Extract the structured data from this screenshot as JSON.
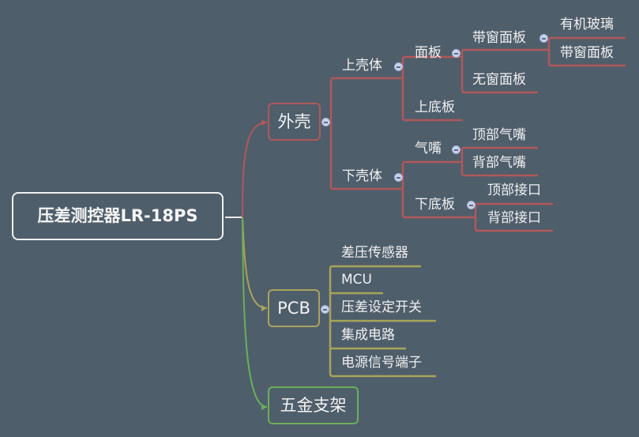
{
  "root": {
    "label": "压差测控器LR-18PS"
  },
  "colors": {
    "background": "#4f5e6b",
    "branch_shell": "#b0585a",
    "branch_pcb": "#a8a35a",
    "branch_hardware": "#6aaf5a",
    "root_border": "#f0f0f0"
  },
  "branches": {
    "shell": {
      "label": "外壳",
      "upper": {
        "label": "上壳体",
        "panel": {
          "label": "面板",
          "window_panel": {
            "label": "带窗面板",
            "children": [
              "有机玻璃",
              "带窗面板"
            ]
          },
          "no_window_panel": {
            "label": "无窗面板"
          }
        },
        "upper_base": {
          "label": "上底板"
        }
      },
      "lower": {
        "label": "下壳体",
        "nozzle": {
          "label": "气嘴",
          "children": [
            "顶部气嘴",
            "背部气嘴"
          ]
        },
        "lower_base": {
          "label": "下底板",
          "children": [
            "顶部接口",
            "背部接口"
          ]
        }
      }
    },
    "pcb": {
      "label": "PCB",
      "children": [
        "差压传感器",
        "MCU",
        "压差设定开关",
        "集成电路",
        "电源信号端子"
      ]
    },
    "hardware": {
      "label": "五金支架"
    }
  },
  "icons": {
    "collapse": "collapse-icon"
  }
}
